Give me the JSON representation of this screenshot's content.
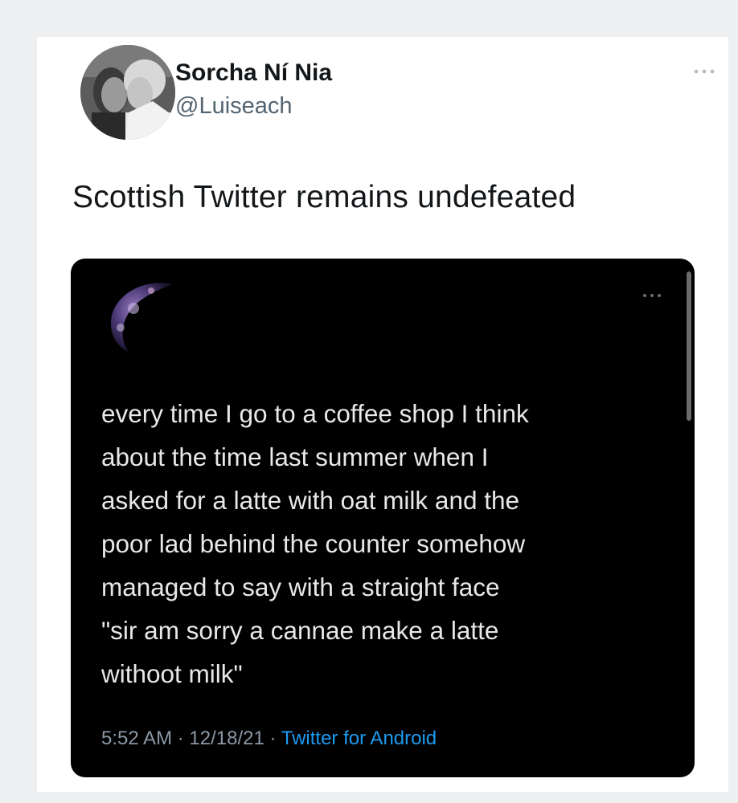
{
  "tweet": {
    "author_name": "Sorcha Ní Nia",
    "author_handle": "@Luiseach",
    "text": "Scottish Twitter remains undefeated",
    "more_icon": "more-horizontal-icon"
  },
  "quoted": {
    "text_lines": [
      "every time I go to a coffee shop I think",
      "about the time last summer when I",
      "asked for a latte with oat milk and the",
      "poor lad behind the counter somehow",
      "managed to say with a straight face",
      "\"sir am sorry a cannae make a latte",
      "withoot milk\""
    ],
    "time": "5:52 AM",
    "date": "12/18/21",
    "separator": "·",
    "source": "Twitter for Android",
    "more_icon": "more-horizontal-icon"
  },
  "colors": {
    "page_bg": "#eeeff1",
    "card_bg": "#ffffff",
    "text_primary": "#14171a",
    "text_secondary": "#536471",
    "embed_bg": "#000000",
    "link_blue": "#1d9bf0"
  }
}
